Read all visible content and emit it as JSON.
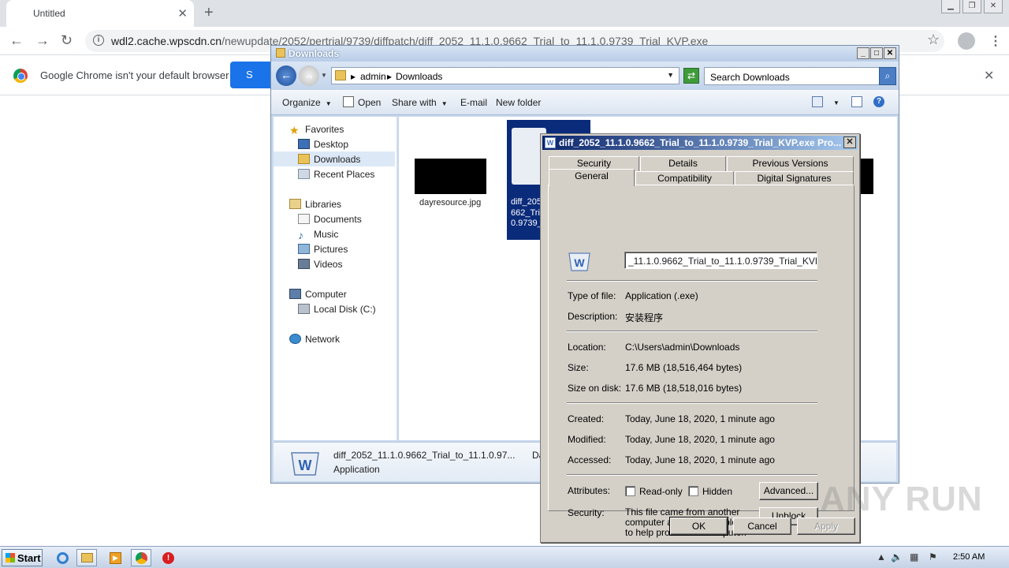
{
  "chrome": {
    "tab_title": "Untitled",
    "url_host": "wdl2.cache.wpscdn.cn",
    "url_path": "/newupdate/2052/pertrial/9739/diffpatch/diff_2052_11.1.0.9662_Trial_to_11.1.0.9739_Trial_KVP.exe",
    "infobar_text": "Google Chrome isn't your default browser",
    "infobar_button": "S"
  },
  "explorer": {
    "title": "Downloads",
    "crumb_1": "admin",
    "crumb_2": "Downloads",
    "search_placeholder": "Search Downloads",
    "commands": {
      "organize": "Organize",
      "open": "Open",
      "share_with": "Share with",
      "email": "E-mail",
      "new_folder": "New folder"
    },
    "nav": {
      "favorites": "Favorites",
      "desktop": "Desktop",
      "downloads": "Downloads",
      "recent_places": "Recent Places",
      "libraries": "Libraries",
      "documents": "Documents",
      "music": "Music",
      "pictures": "Pictures",
      "videos": "Videos",
      "computer": "Computer",
      "local_disk": "Local Disk (C:)",
      "network": "Network"
    },
    "files": {
      "file1_name": "dayresource.jpg",
      "file2_line1": "diff_205",
      "file2_line2": "662_Tri",
      "file2_line3": "0.9739_"
    },
    "details": {
      "name": "diff_2052_11.1.0.9662_Trial_to_11.1.0.97...",
      "date_prefix": "Da",
      "type": "Application"
    }
  },
  "props": {
    "title": "diff_2052_11.1.0.9662_Trial_to_11.1.0.9739_Trial_KVP.exe Pro...",
    "tabs_top": [
      "Security",
      "Details",
      "Previous Versions"
    ],
    "tabs_bottom": [
      "General",
      "Compatibility",
      "Digital Signatures"
    ],
    "file_name": "_11.1.0.9662_Trial_to_11.1.0.9739_Trial_KVP.exe",
    "labels": {
      "type": "Type of file:",
      "description": "Description:",
      "location": "Location:",
      "size": "Size:",
      "size_on_disk": "Size on disk:",
      "created": "Created:",
      "modified": "Modified:",
      "accessed": "Accessed:",
      "attributes": "Attributes:",
      "security": "Security:"
    },
    "values": {
      "type": "Application (.exe)",
      "description": "安装程序",
      "location": "C:\\Users\\admin\\Downloads",
      "size": "17.6 MB (18,516,464 bytes)",
      "size_on_disk": "17.6 MB (18,518,016 bytes)",
      "created": "Today, June 18, 2020, 1 minute ago",
      "modified": "Today, June 18, 2020, 1 minute ago",
      "accessed": "Today, June 18, 2020, 1 minute ago",
      "security_text": "This file came from another computer and might be blocked to help protect this computer."
    },
    "read_only": "Read-only",
    "hidden": "Hidden",
    "advanced": "Advanced...",
    "unblock": "Unblock",
    "ok": "OK",
    "cancel": "Cancel",
    "apply": "Apply"
  },
  "watermark": "ANY RUN",
  "taskbar": {
    "start": "Start",
    "clock": "2:50 AM"
  }
}
